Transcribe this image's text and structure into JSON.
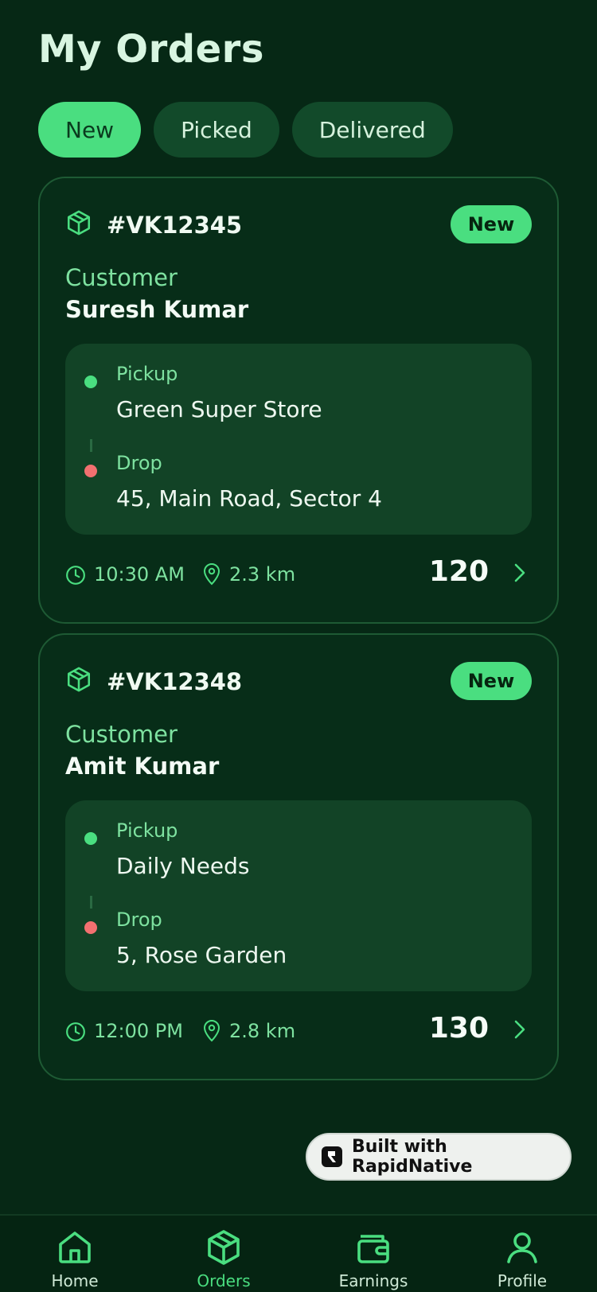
{
  "header": {
    "title": "My Orders"
  },
  "tabs": [
    {
      "label": "New",
      "active": true
    },
    {
      "label": "Picked",
      "active": false
    },
    {
      "label": "Delivered",
      "active": false
    }
  ],
  "orders": [
    {
      "id": "#VK12345",
      "status": "New",
      "customer_label": "Customer",
      "customer_name": "Suresh Kumar",
      "pickup_label": "Pickup",
      "pickup": "Green Super Store",
      "drop_label": "Drop",
      "drop": "45, Main Road, Sector 4",
      "time": "10:30 AM",
      "distance": "2.3 km",
      "amount": "120"
    },
    {
      "id": "#VK12348",
      "status": "New",
      "customer_label": "Customer",
      "customer_name": "Amit Kumar",
      "pickup_label": "Pickup",
      "pickup": "Daily Needs",
      "drop_label": "Drop",
      "drop": "5, Rose Garden",
      "time": "12:00 PM",
      "distance": "2.8 km",
      "amount": "130"
    }
  ],
  "builder_badge": {
    "label": "Built with RapidNative"
  },
  "nav": [
    {
      "label": "Home",
      "icon": "home-icon",
      "active": false
    },
    {
      "label": "Orders",
      "icon": "package-icon",
      "active": true
    },
    {
      "label": "Earnings",
      "icon": "wallet-icon",
      "active": false
    },
    {
      "label": "Profile",
      "icon": "user-icon",
      "active": false
    }
  ],
  "colors": {
    "background": "#062815",
    "accent": "#4ade80",
    "card": "#072d18",
    "route_panel": "#124326",
    "drop_dot": "#f27070"
  }
}
